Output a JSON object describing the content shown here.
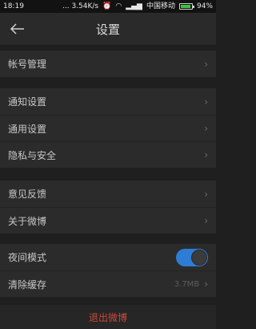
{
  "status_bar": {
    "time": "18:19",
    "speed": "... 3.54K/s",
    "carrier": "中国移动",
    "battery": "94%",
    "battery_level": 0.94
  },
  "header": {
    "title": "设置"
  },
  "groups": [
    {
      "items": [
        {
          "label": "帐号管理"
        }
      ]
    },
    {
      "items": [
        {
          "label": "通知设置"
        },
        {
          "label": "通用设置"
        },
        {
          "label": "隐私与安全"
        }
      ]
    },
    {
      "items": [
        {
          "label": "意见反馈"
        },
        {
          "label": "关于微博"
        }
      ]
    },
    {
      "items": [
        {
          "label": "夜间模式",
          "toggle": true
        },
        {
          "label": "清除缓存",
          "value": "3.7MB"
        }
      ]
    }
  ],
  "logout_label": "退出微博",
  "colors": {
    "toggle_on": "#2d7dd6",
    "logout_text": "#c84a3a"
  }
}
